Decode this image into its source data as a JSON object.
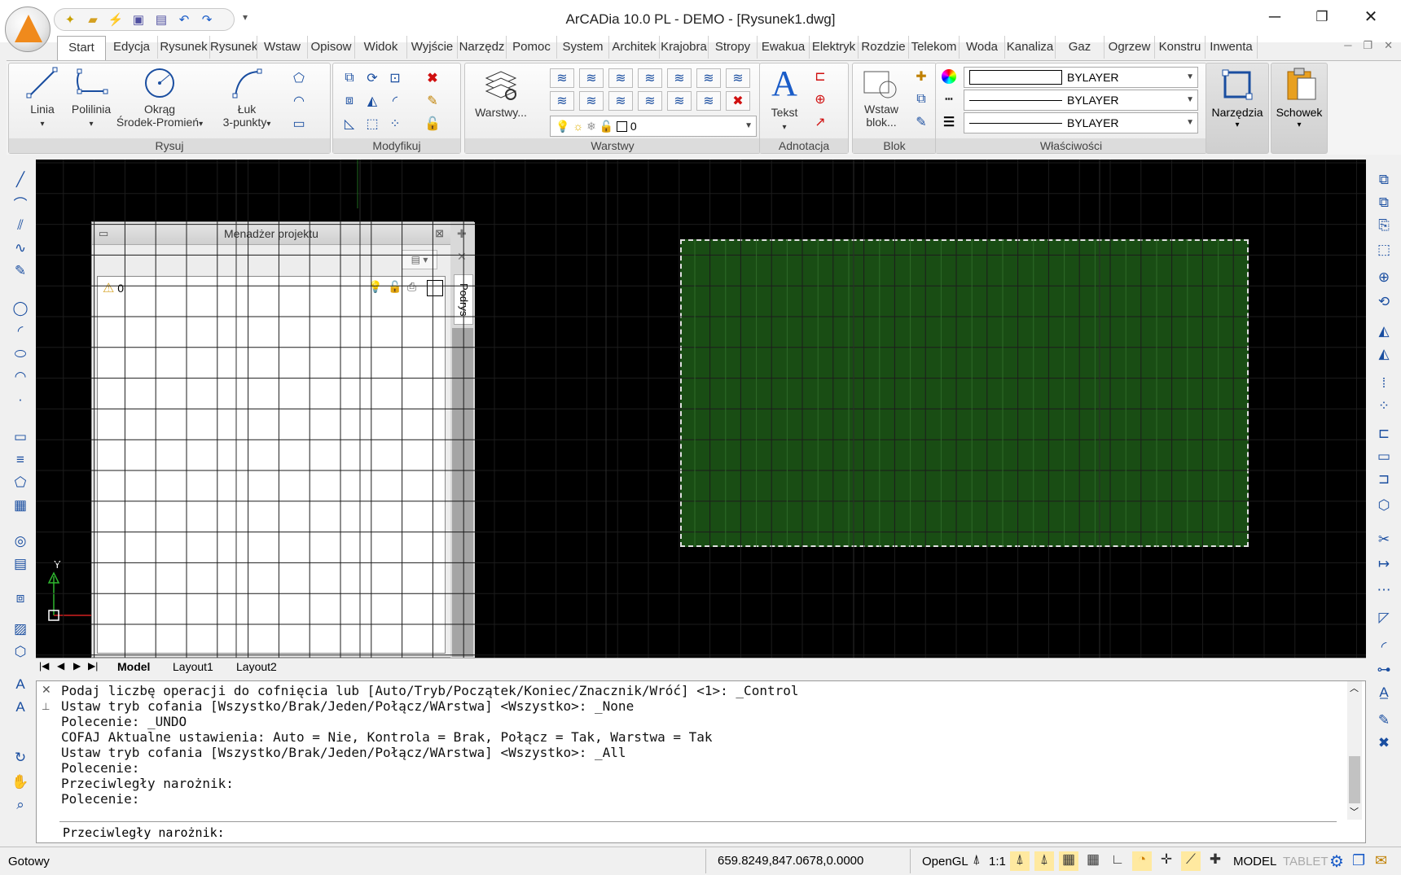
{
  "window": {
    "title": "ArCADia 10.0 PL - DEMO  - [Rysunek1.dwg]",
    "minimize": "─",
    "maximize": "❐",
    "close": "✕",
    "qat_more": "▾"
  },
  "ribbon_tabs": [
    "Start",
    "Edycja",
    "Rysunek",
    "Rysunek",
    "Wstaw",
    "Opisow",
    "Widok",
    "Wyjście",
    "Narzędz",
    "Pomoc",
    "System",
    "Architek",
    "Krajobra",
    "Stropy",
    "Ewakua",
    "Elektryk",
    "Rozdzie",
    "Telekom",
    "Woda",
    "Kanaliza",
    "Gaz",
    "Ogrzew",
    "Konstru",
    "Inwenta"
  ],
  "ribbon": {
    "rysuj": {
      "title": "Rysuj",
      "linia": "Linia",
      "polilinia": "Polilinia",
      "okrag_1": "Okrąg",
      "okrag_2": "Środek-Promień",
      "luk_1": "Łuk",
      "luk_2": "3-punkty"
    },
    "modyfikuj": {
      "title": "Modyfikuj"
    },
    "warstwy": {
      "title": "Warstwy",
      "button": "Warstwy...",
      "current_layer": "0"
    },
    "adnotacja": {
      "title": "Adnotacja",
      "tekst": "Tekst"
    },
    "blok": {
      "title": "Blok",
      "wstaw_1": "Wstaw",
      "wstaw_2": "blok..."
    },
    "wlasciwosci": {
      "title": "Właściwości",
      "color": "BYLAYER",
      "linetype": "BYLAYER",
      "lineweight": "BYLAYER"
    },
    "narzedzia": "Narzędzia",
    "schowek": "Schowek"
  },
  "project_manager": {
    "title": "Menadżer projektu",
    "layer_name": "0",
    "side_tab": "Podrys"
  },
  "canvas": {
    "y_axis_label": "Y",
    "rect_fill": "#194d14",
    "background": "#000000"
  },
  "layout_tabs": [
    "Model",
    "Layout1",
    "Layout2"
  ],
  "command": {
    "history": [
      "Podaj liczbę operacji do cofnięcia lub [Auto/Tryb/Początek/Koniec/Znacznik/Wróć] <1>: _Control",
      "Ustaw tryb cofania [Wszystko/Brak/Jeden/Połącz/WArstwa] <Wszystko>: _None",
      "Polecenie: _UNDO",
      "COFAJ Aktualne ustawienia: Auto = Nie, Kontrola = Brak, Połącz = Tak, Warstwa = Tak",
      "Ustaw tryb cofania [Wszystko/Brak/Jeden/Połącz/WArstwa] <Wszystko>: _All",
      "Polecenie:",
      "Przeciwległy narożnik:",
      "Polecenie:"
    ],
    "prompt": "Przeciwległy narożnik:"
  },
  "status": {
    "state": "Gotowy",
    "coordinates": "659.8249,847.0678,0.0000",
    "renderer": "OpenGL",
    "scale": "1:1",
    "model": "MODEL",
    "tablet": "TABLET"
  }
}
